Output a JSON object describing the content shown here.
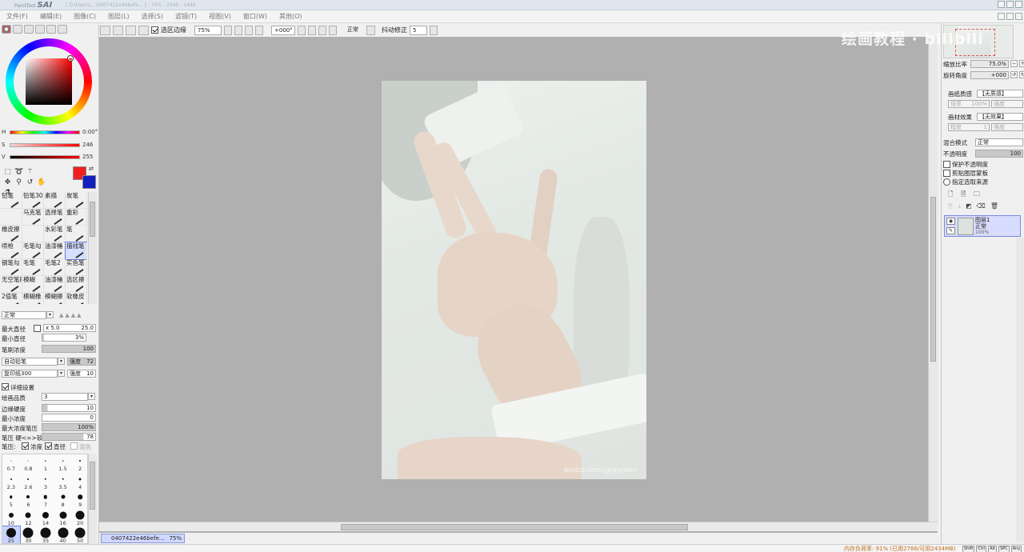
{
  "titlebar": {
    "app_logo_small": "PaintTool",
    "app_logo_big": "SAI",
    "path_text": "[ D:\\Users\\...\\0407422e46befe... ]  - 75% - 2560 - 1440"
  },
  "menu": [
    "文件(F)",
    "编辑(E)",
    "图像(C)",
    "图层(L)",
    "选择(S)",
    "滤镜(T)",
    "视图(V)",
    "窗口(W)",
    "其他(O)"
  ],
  "toolbar": {
    "selection_edge_label": "选区边缘",
    "zoom_value": "75%",
    "rotation_value": "+000°",
    "mode_value": "正常",
    "stabilizer_label": "抖动修正",
    "stabilizer_value": "5"
  },
  "color": {
    "fg": "#f02020",
    "bg": "#1020c0",
    "h_label": "H",
    "h_value": "0:00°",
    "s_label": "S",
    "s_value": "246",
    "v_label": "V",
    "v_value": "255"
  },
  "brushes": [
    {
      "name": "铅笔"
    },
    {
      "name": "铅笔30"
    },
    {
      "name": "素描"
    },
    {
      "name": "炭笔"
    },
    {
      "name": ""
    },
    {
      "name": "马克笔"
    },
    {
      "name": "选择笔"
    },
    {
      "name": "重彩"
    },
    {
      "name": "橡皮擦"
    },
    {
      "name": ""
    },
    {
      "name": "水彩笔"
    },
    {
      "name": "笔"
    },
    {
      "name": "喷枪"
    },
    {
      "name": "毛笔勾"
    },
    {
      "name": "油漆桶"
    },
    {
      "name": "描线笔"
    },
    {
      "name": "钢笔勾"
    },
    {
      "name": "毛笔"
    },
    {
      "name": "毛笔2"
    },
    {
      "name": "实色笔"
    },
    {
      "name": "无空笔刷"
    },
    {
      "name": "模糊"
    },
    {
      "name": "油漆桶"
    },
    {
      "name": "选区擦"
    },
    {
      "name": "2值笔"
    },
    {
      "name": "模糊橡"
    },
    {
      "name": "模糊擦"
    },
    {
      "name": "软橡皮"
    }
  ],
  "brush_props": {
    "mode_value": "正常",
    "max_size_label": "最大直径",
    "max_size_mult": "x 5.0",
    "max_size_value": "25.0",
    "min_size_label": "最小直径",
    "min_size_value": "3%",
    "density_label": "笔刷浓度",
    "density_value": "100",
    "shape_value": "自动铅笔",
    "shape_strength_label": "强度",
    "shape_strength_value": "72",
    "texture_value": "复印纸300",
    "texture_strength_label": "强度",
    "texture_strength_value": "10",
    "advanced_label": "详细设置",
    "quality_label": "绘画品质",
    "quality_value": "3",
    "edge_label": "边缘硬度",
    "edge_value": "10",
    "min_density_label": "最小浓度",
    "min_density_value": "0",
    "max_pressure_label": "最大浓度笔压",
    "max_pressure_value": "100%",
    "pressure_label": "笔压 硬<=>软",
    "pressure_value": "78",
    "pressure2_label": "笔压:",
    "pressure_density_label": "浓度",
    "pressure_size_label": "直径",
    "pressure_blend_label": "混色"
  },
  "dot_sizes": [
    {
      "label": "0.7",
      "d": 1
    },
    {
      "label": "0.8",
      "d": 1
    },
    {
      "label": "1",
      "d": 1.5
    },
    {
      "label": "1.5",
      "d": 1.5
    },
    {
      "label": "2",
      "d": 2
    },
    {
      "label": "2.3",
      "d": 2
    },
    {
      "label": "2.6",
      "d": 2
    },
    {
      "label": "3",
      "d": 2.5
    },
    {
      "label": "3.5",
      "d": 2.5
    },
    {
      "label": "4",
      "d": 3
    },
    {
      "label": "5",
      "d": 3.5
    },
    {
      "label": "6",
      "d": 4
    },
    {
      "label": "7",
      "d": 4.5
    },
    {
      "label": "8",
      "d": 5
    },
    {
      "label": "9",
      "d": 5.5
    },
    {
      "label": "10",
      "d": 6
    },
    {
      "label": "12",
      "d": 7
    },
    {
      "label": "14",
      "d": 8
    },
    {
      "label": "16",
      "d": 9
    },
    {
      "label": "20",
      "d": 11
    },
    {
      "label": "25",
      "d": 12
    },
    {
      "label": "30",
      "d": 13
    },
    {
      "label": "35",
      "d": 13
    },
    {
      "label": "40",
      "d": 13
    },
    {
      "label": "50",
      "d": 13
    }
  ],
  "document": {
    "tab_name": "0407422e46befe...",
    "tab_zoom": "75%",
    "photo_watermark": "weibo.com/greymon"
  },
  "right": {
    "zoom_label": "缩放比率",
    "zoom_value": "75.0%",
    "angle_label": "旋转角度",
    "angle_value": "+000",
    "paper_texture_label": "画纸质感",
    "paper_texture_value": "【无质感】",
    "paper_scale_label": "倍率",
    "paper_scale_value": "100%",
    "paper_strength_label": "强度",
    "paper_effect_label": "画材效果",
    "paper_effect_value": "【无效果】",
    "effect_degree_label": "程度",
    "effect_degree_value": "1",
    "effect_strength_label": "强度",
    "blend_mode_label": "混合模式",
    "blend_mode_value": "正常",
    "opacity_label": "不透明度",
    "opacity_value": "100",
    "protect_opacity_label": "保护不透明度",
    "clip_label": "剪贴图层蒙板",
    "select_source_label": "指定选取来源",
    "layer_name": "图层1",
    "layer_mode": "正常",
    "layer_opacity": "100%"
  },
  "status": {
    "memory_text": "内存负荷率: 91% (已用2786/可用2434MB)",
    "keys": [
      "Shift",
      "Ctrl",
      "Alt",
      "SPC",
      "Any"
    ]
  },
  "overlay": {
    "brand_text": "绘画教程 ·  bilibili"
  }
}
